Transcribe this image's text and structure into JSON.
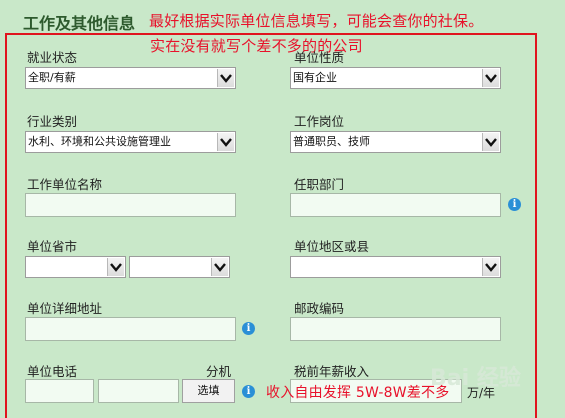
{
  "section_title": "工作及其他信息",
  "annotations": {
    "line1": "最好根据实际单位信息填写，可能会查你的社保。",
    "line2": "实在没有就写个差不多的的公司",
    "salary_note": "收入自由发挥 5W-8W差不多"
  },
  "fields": {
    "employment_status": {
      "label": "就业状态",
      "value": "全职/有薪"
    },
    "company_nature": {
      "label": "单位性质",
      "value": "国有企业"
    },
    "industry": {
      "label": "行业类别",
      "value": "水利、环境和公共设施管理业"
    },
    "position": {
      "label": "工作岗位",
      "value": "普通职员、技师"
    },
    "company_name": {
      "label": "工作单位名称",
      "value": ""
    },
    "department": {
      "label": "任职部门",
      "value": ""
    },
    "province_city": {
      "label": "单位省市",
      "province": "",
      "city": ""
    },
    "district": {
      "label": "单位地区或县",
      "value": ""
    },
    "address": {
      "label": "单位详细地址",
      "value": ""
    },
    "postcode": {
      "label": "邮政编码",
      "value": ""
    },
    "phone": {
      "label": "单位电话",
      "extension_label": "分机",
      "ext_button": "选填"
    },
    "income": {
      "label": "税前年薪收入",
      "unit": "万/年"
    }
  },
  "info_icon_glyph": "i",
  "watermark": "Bai 经验",
  "colors": {
    "background": "#c9e8c9",
    "annotation": "#e8122b",
    "title": "#2d5a2d",
    "info": "#2a8fd6"
  }
}
